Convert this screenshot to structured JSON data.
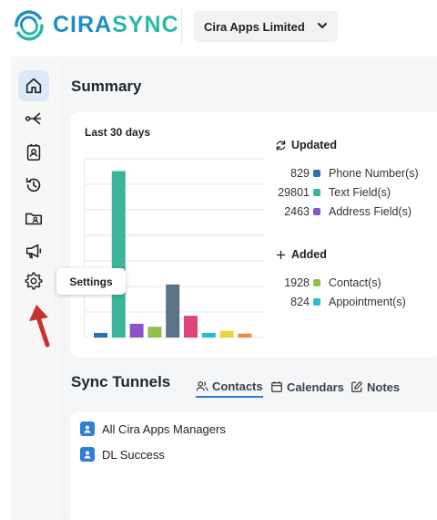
{
  "header": {
    "brand_part1": "CIRA",
    "brand_part2": "SYNC",
    "org_name": "Cira Apps Limited"
  },
  "sidebar": {
    "items": [
      {
        "icon": "home-icon",
        "active": true
      },
      {
        "icon": "share-icon",
        "active": false
      },
      {
        "icon": "contact-card-icon",
        "active": false
      },
      {
        "icon": "history-icon",
        "active": false
      },
      {
        "icon": "folder-contact-icon",
        "active": false
      },
      {
        "icon": "megaphone-icon",
        "active": false
      },
      {
        "icon": "gear-icon",
        "active": false
      }
    ],
    "tooltip": "Settings"
  },
  "summary": {
    "title": "Summary",
    "period": "Last 30 days",
    "updated_label": "Updated",
    "added_label": "Added"
  },
  "chart_data": {
    "type": "bar",
    "categories": [
      "Phone Number(s)",
      "Text Field(s)",
      "Address Field(s)",
      "Contact(s)",
      "Appointment(s)"
    ],
    "values": [
      829,
      29801,
      2463,
      1928,
      824
    ],
    "colors": [
      "#2e6fb3",
      "#3ab59c",
      "#8a55c7",
      "#8dc24c",
      "#2bbcd4"
    ],
    "extra_unlabeled_bars": [
      {
        "value": 9500,
        "color": "#5a7387"
      },
      {
        "value": 3900,
        "color": "#e0437a"
      },
      {
        "value": 1200,
        "color": "#f2d13a"
      },
      {
        "value": 700,
        "color": "#f28a3a"
      }
    ],
    "ylim": [
      0,
      32000
    ],
    "grid": true,
    "legend_groups": [
      {
        "group": "Updated",
        "entries": [
          {
            "name": "Phone Number(s)",
            "value": 829,
            "color": "#2e6fb3"
          },
          {
            "name": "Text Field(s)",
            "value": 29801,
            "color": "#3ab59c"
          },
          {
            "name": "Address Field(s)",
            "value": 2463,
            "color": "#8a55c7"
          }
        ]
      },
      {
        "group": "Added",
        "entries": [
          {
            "name": "Contact(s)",
            "value": 1928,
            "color": "#8dc24c"
          },
          {
            "name": "Appointment(s)",
            "value": 824,
            "color": "#2bbcd4"
          }
        ]
      }
    ]
  },
  "sync": {
    "title": "Sync Tunnels",
    "tabs": [
      "Contacts",
      "Calendars",
      "Notes"
    ],
    "active_tab": "Contacts",
    "tunnels": [
      "All Cira Apps Managers",
      "DL Success"
    ]
  }
}
